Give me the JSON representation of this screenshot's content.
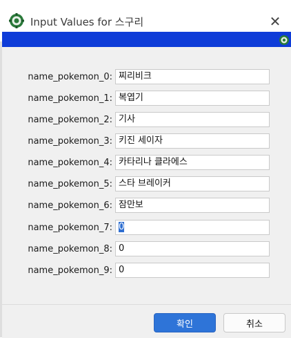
{
  "window": {
    "title": "Input Values for 스구리",
    "close_glyph": "✕"
  },
  "fields": [
    {
      "label": "name_pokemon_0:",
      "value": "찌리비크"
    },
    {
      "label": "name_pokemon_1:",
      "value": "복엽기"
    },
    {
      "label": "name_pokemon_2:",
      "value": "기사"
    },
    {
      "label": "name_pokemon_3:",
      "value": "키진 세이자"
    },
    {
      "label": "name_pokemon_4:",
      "value": "카타리나 클라에스"
    },
    {
      "label": "name_pokemon_5:",
      "value": "스타 브레이커"
    },
    {
      "label": "name_pokemon_6:",
      "value": "잠만보"
    },
    {
      "label": "name_pokemon_7:",
      "value": "0",
      "selected": true
    },
    {
      "label": "name_pokemon_8:",
      "value": "0"
    },
    {
      "label": "name_pokemon_9:",
      "value": "0"
    }
  ],
  "buttons": {
    "ok_label": "확인",
    "cancel_label": "취소"
  },
  "colors": {
    "accent_bar": "#0e3cd8",
    "ok_button": "#2e74d8"
  },
  "icons": {
    "app": "app-gear-icon",
    "bar": "small-gear-icon"
  }
}
